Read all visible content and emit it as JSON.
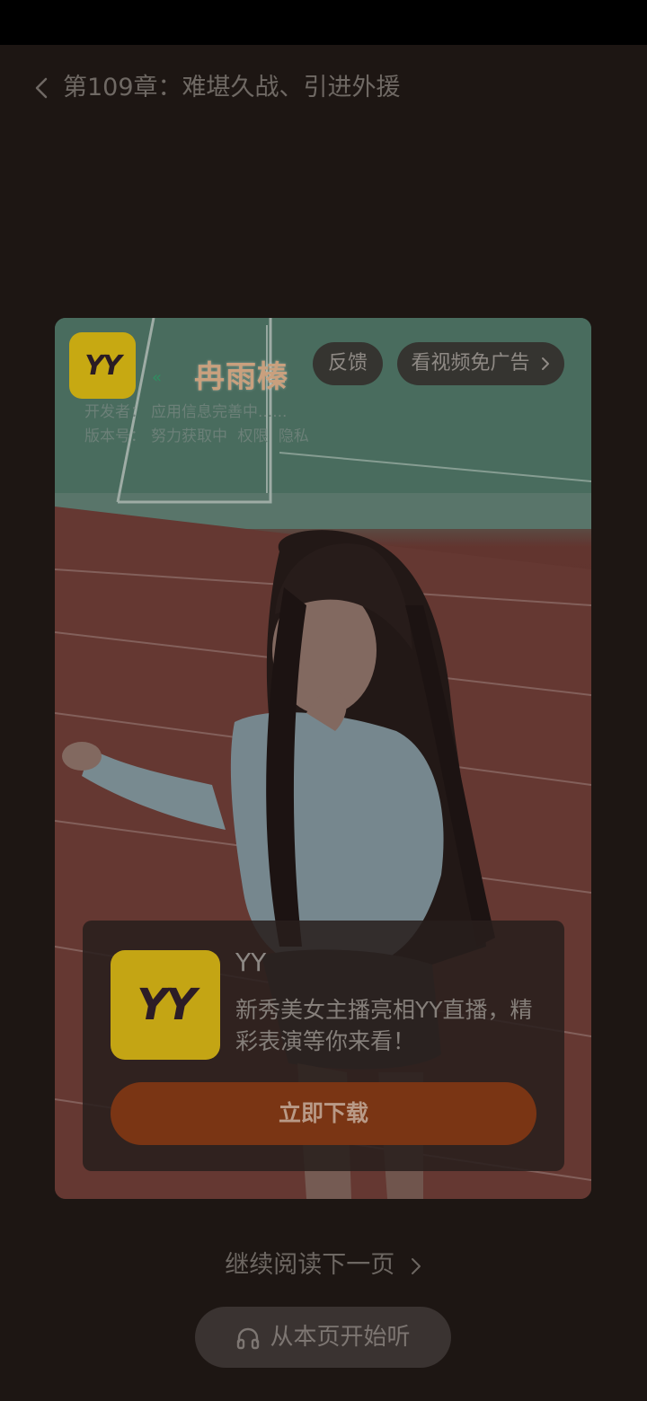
{
  "header": {
    "back_icon": "chevron-left-icon",
    "chapter_title": "第109章：难堪久战、引进外援"
  },
  "ad": {
    "brand_logo_text": "YY",
    "brand_name": "冉雨榛",
    "feedback_label": "反馈",
    "no_ad_label": "看视频免广告",
    "meta": {
      "developer_label": "开发者：",
      "developer_value": "应用信息完善中......",
      "version_label": "版本号：",
      "version_value": "努力获取中",
      "permissions": "权限",
      "privacy": "隐私"
    },
    "app_name": "YY",
    "app_description": "新秀美女主播亮相YY直播，精彩表演等你来看！",
    "download_label": "立即下载"
  },
  "footer": {
    "continue_label": "继续阅读下一页",
    "listen_label": "从本页开始听",
    "listen_icon": "headphones-icon"
  },
  "colors": {
    "page_background": "#1d1613",
    "download_button": "#7a3514",
    "yy_brand": "#c4a514"
  }
}
